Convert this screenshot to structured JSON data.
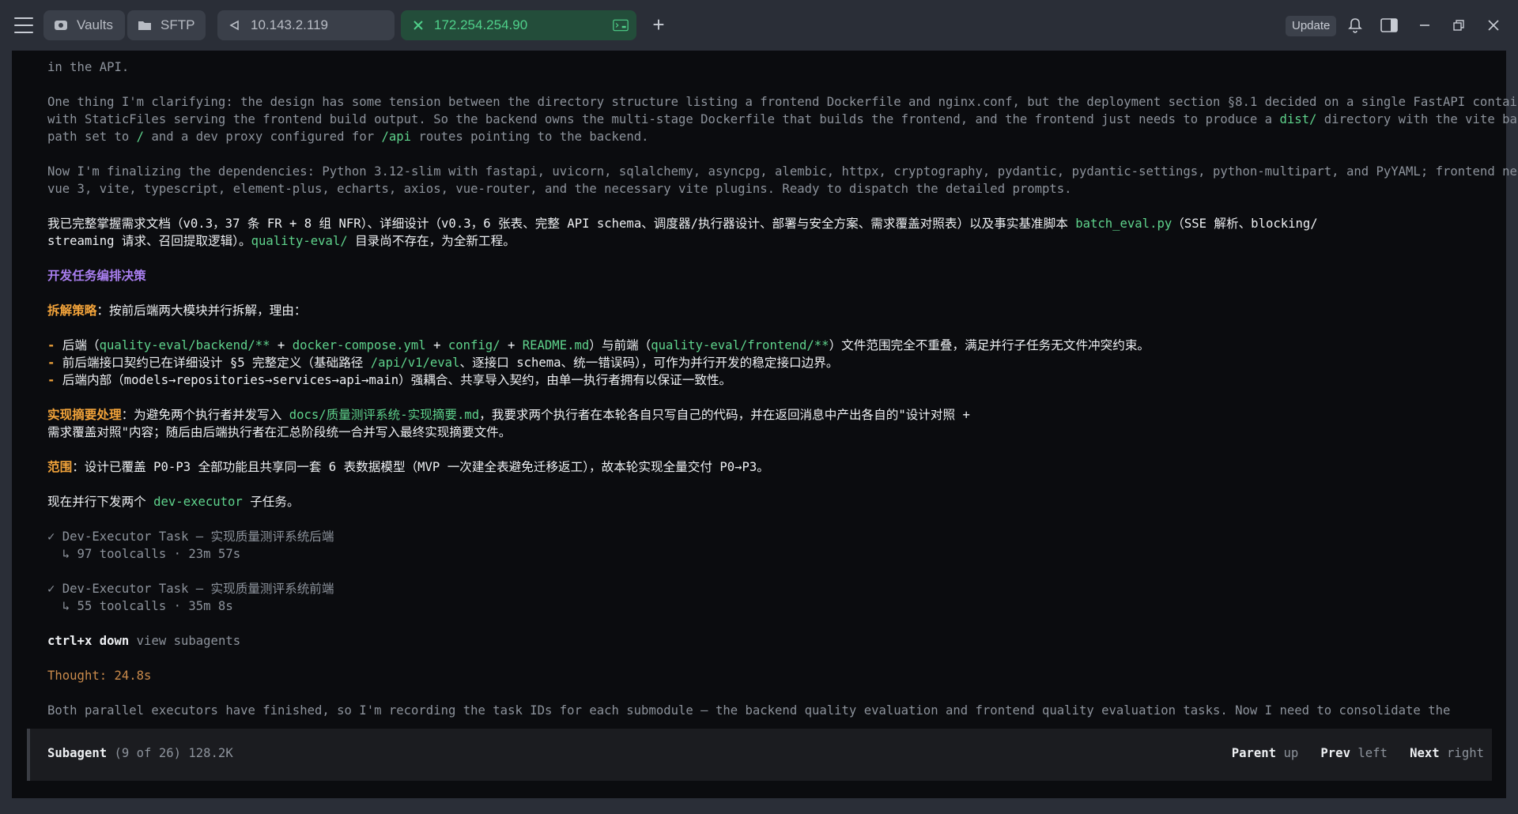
{
  "tabs": [
    {
      "label": "Vaults",
      "icon": "vault-icon"
    },
    {
      "label": "SFTP",
      "icon": "folder-icon"
    },
    {
      "label": "10.143.2.119",
      "icon": "disconnected-icon"
    },
    {
      "label": "172.254.254.90",
      "icon": "close-icon",
      "trailing_icon": "terminal-icon"
    }
  ],
  "toolbar": {
    "update_label": "Update"
  },
  "lines": {
    "l1": "in the API.",
    "l2": "One thing I'm clarifying: the design has some tension between the directory structure listing a frontend Dockerfile and nginx.conf, but the deployment section §8.1 decided on a single FastAPI container",
    "l3a": "with StaticFiles serving the frontend build output. So the backend owns the multi-stage Dockerfile that builds the frontend, and the frontend just needs to produce a ",
    "l3b": "dist/",
    "l3c": " directory with the vite base",
    "l4a": "path set to ",
    "l4b": "/",
    "l4c": " and a dev proxy configured for ",
    "l4d": "/api",
    "l4e": " routes pointing to the backend.",
    "l5": "Now I'm finalizing the dependencies: Python 3.12-slim with fastapi, uvicorn, sqlalchemy, asyncpg, alembic, httpx, cryptography, pydantic, pydantic-settings, python-multipart, and PyYAML; frontend needs",
    "l6": "vue 3, vite, typescript, element-plus, echarts, axios, vue-router, and the necessary vite plugins. Ready to dispatch the detailed prompts.",
    "l7a": "我已完整掌握需求文档（v0.3，37 条 FR + 8 组 NFR）、详细设计（v0.3，6 张表、完整 API schema、调度器/执行器设计、部署与安全方案、需求覆盖对照表）以及事实基准脚本 ",
    "l7b": "batch_eval.py",
    "l7c": "（SSE 解析、blocking/",
    "l8a": "streaming 请求、召回提取逻辑）。",
    "l8b": "quality-eval/",
    "l8c": " 目录尚不存在，为全新工程。",
    "h1": "开发任务编排决策",
    "l9a": "拆解策略",
    "l9b": "：按前后端两大模块并行拆解，理由：",
    "b1a": "- ",
    "b1b": "后端（",
    "b1c": "quality-eval/backend/**",
    "b1d": " + ",
    "b1e": "docker-compose.yml",
    "b1f": " + ",
    "b1g": "config/",
    "b1h": " + ",
    "b1i": "README.md",
    "b1j": "）与前端（",
    "b1k": "quality-eval/frontend/**",
    "b1l": "）文件范围完全不重叠，满足并行子任务无文件冲突约束。",
    "b2a": "- ",
    "b2b": "前后端接口契约已在详细设计 §5 完整定义（基础路径 ",
    "b2c": "/api/v1/eval",
    "b2d": "、逐接口 schema、统一错误码），可作为并行开发的稳定接口边界。",
    "b3a": "- ",
    "b3b": "后端内部（models→repositories→services→api→main）强耦合、共享导入契约，由单一执行者拥有以保证一致性。",
    "l10a": "实现摘要处理",
    "l10b": "：为避免两个执行者并发写入 ",
    "l10c": "docs/质量测评系统-实现摘要.md",
    "l10d": "，我要求两个执行者在本轮各自只写自己的代码，并在返回消息中产出各自的\"设计对照 +",
    "l11": "需求覆盖对照\"内容；随后由后端执行者在汇总阶段统一合并写入最终实现摘要文件。",
    "l12a": "范围",
    "l12b": "：设计已覆盖 P0-P3 全部功能且共享同一套 6 表数据模型（MVP 一次建全表避免迁移返工），故本轮实现全量交付 P0→P3。",
    "l13a": "现在并行下发两个 ",
    "l13b": "dev-executor",
    "l13c": " 子任务。",
    "t1": "✓ Dev-Executor Task — 实现质量测评系统后端",
    "t1s": "  ↳ 97 toolcalls · 23m 57s",
    "t2": "✓ Dev-Executor Task — 实现质量测评系统前端",
    "t2s": "  ↳ 55 toolcalls · 35m 8s",
    "k1": "ctrl+x down",
    "k2": " view subagents",
    "thought": "Thought: 24.8s",
    "last": "Both parallel executors have finished, so I'm recording the task IDs for each submodule — the backend quality evaluation and frontend quality evaluation tasks. Now I need to consolidate the"
  },
  "footer": {
    "title": "Subagent",
    "meta": " (9 of 26) 128.2K",
    "parent": "Parent",
    "parent_key": " up",
    "prev": "Prev",
    "prev_key": " left",
    "next": "Next",
    "next_key": " right"
  }
}
